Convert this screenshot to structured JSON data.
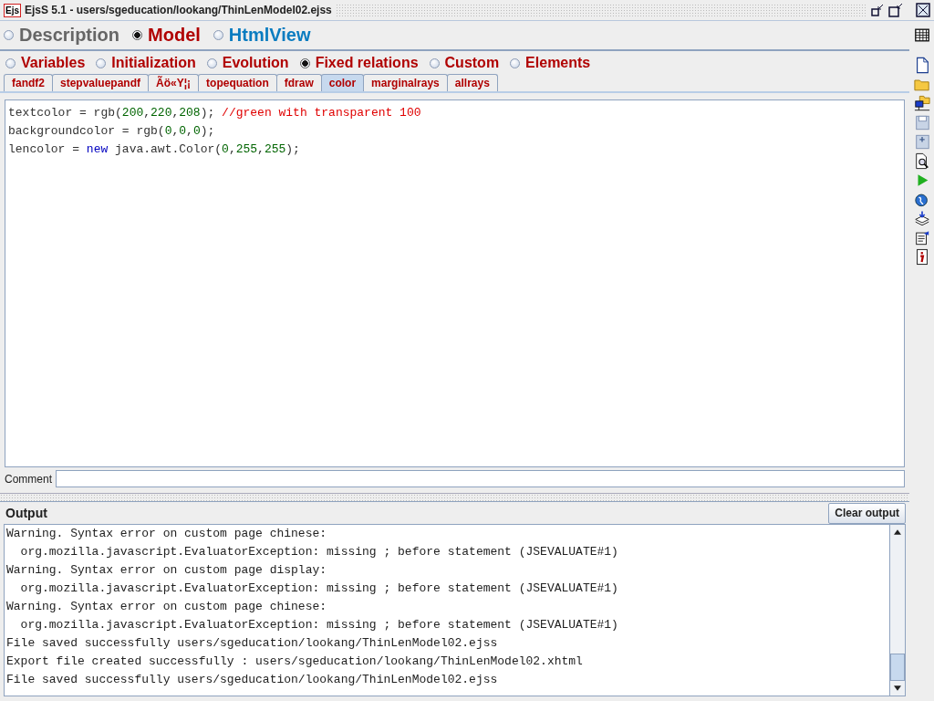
{
  "window": {
    "title": "EjsS 5.1 - users/sgeducation/lookang/ThinLenModel02.ejss",
    "logo": "Ejs"
  },
  "views": [
    {
      "label": "Description",
      "selected": false,
      "color": "#666666"
    },
    {
      "label": "Model",
      "selected": true,
      "color": "#b00000"
    },
    {
      "label": "HtmlView",
      "selected": false,
      "color": "#0a7cc0"
    }
  ],
  "sections": [
    {
      "label": "Variables",
      "selected": false
    },
    {
      "label": "Initialization",
      "selected": false
    },
    {
      "label": "Evolution",
      "selected": false
    },
    {
      "label": "Fixed relations",
      "selected": true
    },
    {
      "label": "Custom",
      "selected": false
    },
    {
      "label": "Elements",
      "selected": false
    }
  ],
  "tabs": [
    {
      "label": "fandf2",
      "selected": false
    },
    {
      "label": "stepvaluepandf",
      "selected": false
    },
    {
      "label": "Ãö«Y¦¡",
      "selected": false
    },
    {
      "label": "topequation",
      "selected": false
    },
    {
      "label": "fdraw",
      "selected": false
    },
    {
      "label": "color",
      "selected": true
    },
    {
      "label": "marginalrays",
      "selected": false
    },
    {
      "label": "allrays",
      "selected": false
    }
  ],
  "code": [
    [
      {
        "text": "textcolor = rgb(",
        "kind": "plain"
      },
      {
        "text": "200",
        "kind": "number"
      },
      {
        "text": ",",
        "kind": "plain"
      },
      {
        "text": "220",
        "kind": "number"
      },
      {
        "text": ",",
        "kind": "plain"
      },
      {
        "text": "208",
        "kind": "number"
      },
      {
        "text": "); ",
        "kind": "plain"
      },
      {
        "text": "//green with transparent 100",
        "kind": "comment"
      }
    ],
    [
      {
        "text": "backgroundcolor = rgb(",
        "kind": "plain"
      },
      {
        "text": "0",
        "kind": "number"
      },
      {
        "text": ",",
        "kind": "plain"
      },
      {
        "text": "0",
        "kind": "number"
      },
      {
        "text": ",",
        "kind": "plain"
      },
      {
        "text": "0",
        "kind": "number"
      },
      {
        "text": ");",
        "kind": "plain"
      }
    ],
    [
      {
        "text": "lencolor = ",
        "kind": "plain"
      },
      {
        "text": "new",
        "kind": "keyword"
      },
      {
        "text": " java.awt.Color(",
        "kind": "plain"
      },
      {
        "text": "0",
        "kind": "number"
      },
      {
        "text": ",",
        "kind": "plain"
      },
      {
        "text": "255",
        "kind": "number"
      },
      {
        "text": ",",
        "kind": "plain"
      },
      {
        "text": "255",
        "kind": "number"
      },
      {
        "text": ");",
        "kind": "plain"
      }
    ]
  ],
  "comment": {
    "label": "Comment"
  },
  "output": {
    "title": "Output",
    "clear_button": "Clear output",
    "lines": [
      "Warning. Syntax error on custom page chinese:",
      "  org.mozilla.javascript.EvaluatorException: missing ; before statement (JSEVALUATE#1)",
      "Warning. Syntax error on custom page display:",
      "  org.mozilla.javascript.EvaluatorException: missing ; before statement (JSEVALUATE#1)",
      "Warning. Syntax error on custom page chinese:",
      "  org.mozilla.javascript.EvaluatorException: missing ; before statement (JSEVALUATE#1)",
      "File saved successfully users/sgeducation/lookang/ThinLenModel02.ejss",
      "Export file created successfully : users/sgeducation/lookang/ThinLenModel02.xhtml",
      "File saved successfully users/sgeducation/lookang/ThinLenModel02.ejss"
    ]
  }
}
